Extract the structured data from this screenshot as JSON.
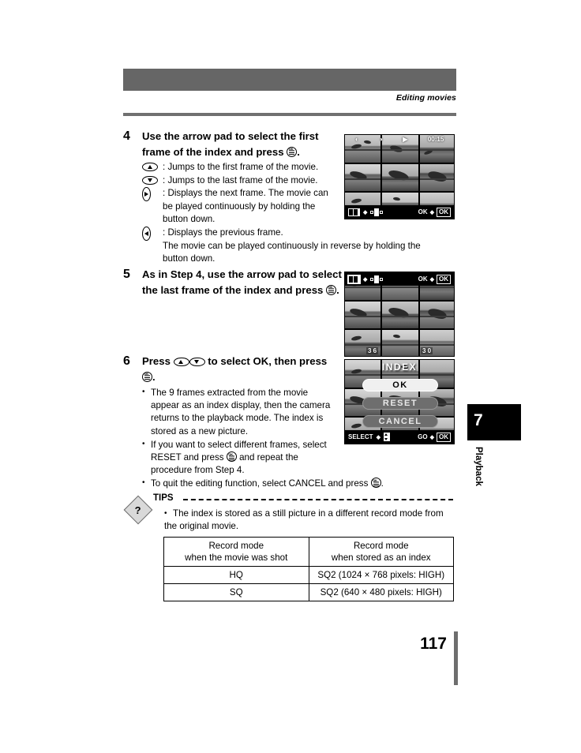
{
  "header": {
    "caption": "Editing movies"
  },
  "steps": [
    {
      "number": "4",
      "heading_pre": "Use the arrow pad to select the first frame of the index and press",
      "heading_post": ".",
      "keys": [
        {
          "icon": "arrow-pad-up-icon",
          "text": ": Jumps to the first frame of the movie."
        },
        {
          "icon": "arrow-pad-down-icon",
          "text": ": Jumps to the last frame of the movie."
        },
        {
          "icon": "arrow-pad-right-icon",
          "text": ": Displays the next frame. The movie can",
          "cont": [
            "be played continuously by holding the",
            "button down."
          ]
        },
        {
          "icon": "arrow-pad-left-icon",
          "text": ": Displays the previous frame.",
          "cont": [
            "The movie can be played continuously in reverse by holding the",
            "button down."
          ]
        }
      ]
    },
    {
      "number": "5",
      "heading_pre": "As in Step 4, use the arrow pad to select the last frame of the index and press",
      "heading_post": "."
    },
    {
      "number": "6",
      "heading_a": "Press",
      "heading_b": "to select OK, then press",
      "heading_post": ".",
      "bullets": [
        {
          "text": "The 9 frames extracted from the movie appear as an index display, then the camera returns to the playback mode. The index is stored as a new picture."
        },
        {
          "pre": "If you want to select different frames, select RESET and press",
          "post": "and repeat the procedure from Step 4."
        },
        {
          "pre": "To quit the editing function, select CANCEL and press",
          "post": "."
        }
      ]
    }
  ],
  "lcd1": {
    "bar": {
      "index_icon": "index-frame-icon",
      "diamond": "◆",
      "pad_icon": "arrow-pad-lr-icon",
      "ok_label": "OK",
      "ok_button": "OK"
    },
    "top_counter": [
      "◐",
      "◑",
      "▶",
      "00:15"
    ]
  },
  "lcd2": {
    "bar": {
      "index_icon": "index-frame-icon",
      "diamond": "◆",
      "pad_icon": "arrow-pad-lr-icon",
      "ok_label": "OK",
      "ok_button": "OK"
    },
    "ticker": [
      "3 6",
      "3 0"
    ]
  },
  "lcd3": {
    "title": "INDEX",
    "items": [
      {
        "label": "OK",
        "selected": true
      },
      {
        "label": "RESET",
        "selected": false
      },
      {
        "label": "CANCEL",
        "selected": false
      }
    ],
    "bar": {
      "select_label": "SELECT",
      "diamond": "◆",
      "ud_icon": "arrow-pad-ud-icon",
      "go_label": "GO",
      "ok_button": "OK"
    }
  },
  "tips": {
    "icon_text": "?",
    "heading": "TIPS",
    "body": "The index is stored as a still picture in a different record mode from the original movie."
  },
  "table": {
    "headers": [
      "Record mode\nwhen the movie was shot",
      "Record mode\nwhen stored as an index"
    ],
    "header_a_line1": "Record mode",
    "header_a_line2": "when the movie was shot",
    "header_b_line1": "Record mode",
    "header_b_line2": "when stored as an index",
    "rows": [
      {
        "a": "HQ",
        "b": "SQ2 (1024 × 768 pixels: HIGH)"
      },
      {
        "a": "SQ",
        "b": "SQ2 (640 × 480 pixels: HIGH)"
      }
    ]
  },
  "chapter": {
    "number": "7",
    "label": "Playback"
  },
  "footer": {
    "page_number": "117"
  },
  "colors": {
    "header_bar": "#666666",
    "rule": "#707070",
    "tab": "#000000",
    "tips_icon": "#d9d9d9"
  }
}
